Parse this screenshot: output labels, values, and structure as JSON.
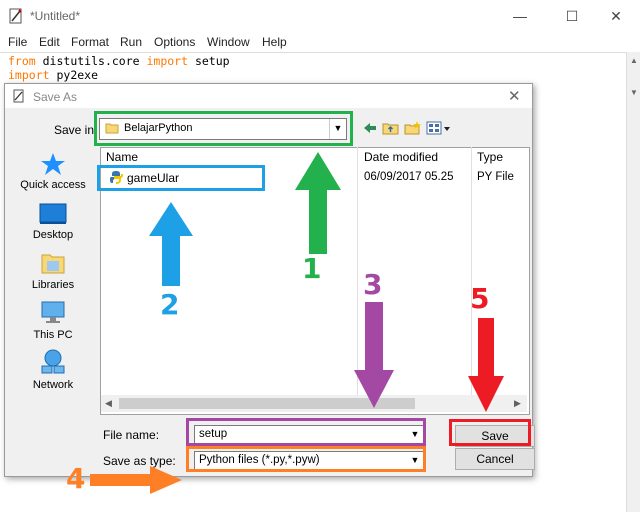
{
  "editor": {
    "title": "*Untitled*",
    "window_controls": [
      "—",
      "☐",
      "✕"
    ],
    "menu": [
      "File",
      "Edit",
      "Format",
      "Run",
      "Options",
      "Window",
      "Help"
    ],
    "code": [
      {
        "kw1": "from",
        "t1": " distutils.core ",
        "kw2": "import",
        "t2": " setup"
      },
      {
        "kw1": "import",
        "t1": " py2exe",
        "kw2": "",
        "t2": ""
      }
    ]
  },
  "dialog": {
    "title": "Save As",
    "save_in_label": "Save in:",
    "save_in_value": "BelajarPython",
    "places": [
      "Quick access",
      "Desktop",
      "Libraries",
      "This PC",
      "Network"
    ],
    "columns": [
      "Name",
      "Date modified",
      "Type"
    ],
    "files": [
      {
        "name": "gameUlar",
        "date": "06/09/2017 05.25",
        "type": "PY File"
      }
    ],
    "file_name_label": "File name:",
    "file_name_value": "setup",
    "save_type_label": "Save as type:",
    "save_type_value": "Python files (*.py,*.pyw)",
    "save_label": "Save",
    "cancel_label": "Cancel"
  },
  "annotations": {
    "numbers": [
      "1",
      "2",
      "3",
      "4",
      "5"
    ],
    "colors": {
      "green": "#22b14c",
      "blue": "#1ea0e6",
      "purple": "#a349a4",
      "orange": "#ff7f27",
      "red": "#ed1c24"
    }
  },
  "colors": {
    "keyword": "#ff7700",
    "dialog_bg": "#f0f0f0"
  }
}
